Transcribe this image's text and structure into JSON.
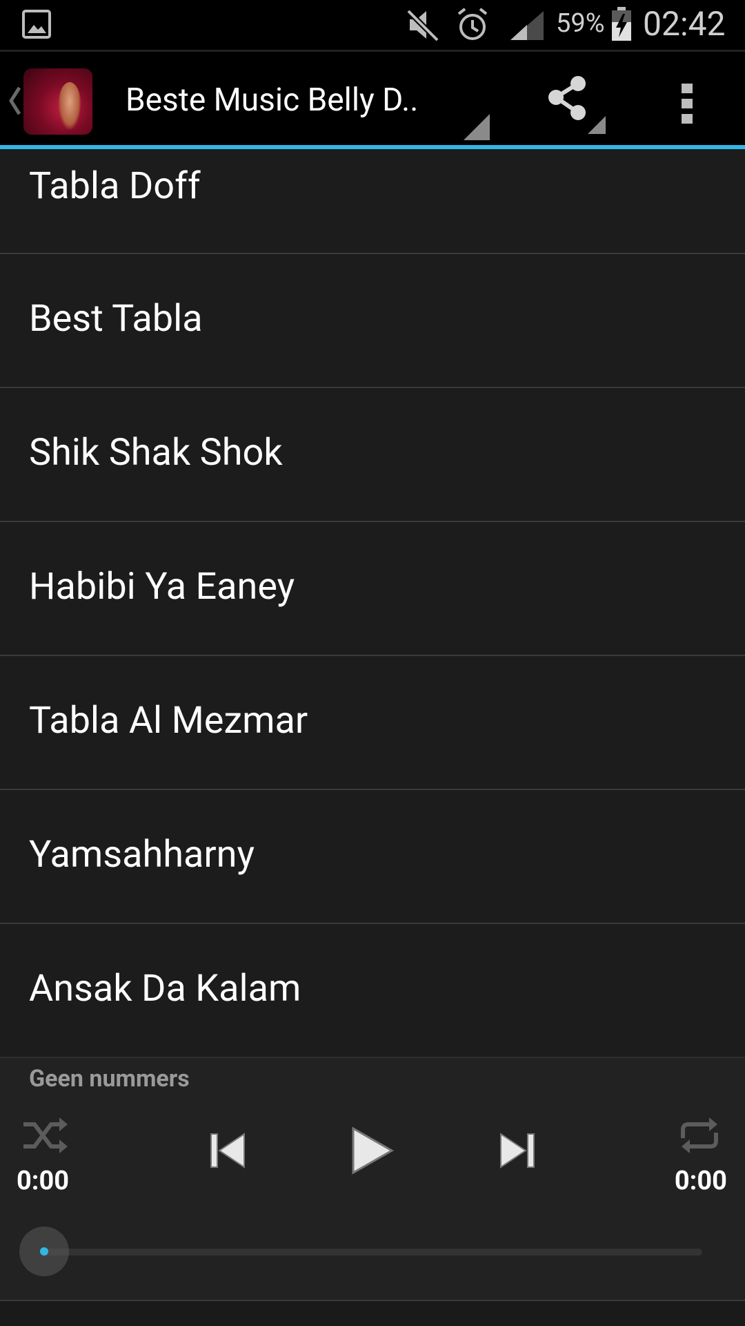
{
  "status_bar": {
    "icons": [
      "gallery-icon",
      "mute-icon",
      "alarm-icon",
      "signal-icon",
      "battery-charging-icon"
    ],
    "battery_percent": "59%",
    "time": "02:42"
  },
  "action_bar": {
    "title": "Beste Music Belly D..",
    "icons": [
      "up-caret-icon",
      "share-icon",
      "overflow-menu-icon"
    ],
    "accent_color": "#33b5e5"
  },
  "songs": [
    {
      "title": "Tabla Doff"
    },
    {
      "title": "Best Tabla"
    },
    {
      "title": "Shik Shak Shok"
    },
    {
      "title": "Habibi Ya Eaney"
    },
    {
      "title": "Tabla Al Mezmar"
    },
    {
      "title": "Yamsahharny"
    },
    {
      "title": "Ansak Da Kalam"
    }
  ],
  "player": {
    "now_playing": "Geen nummers",
    "elapsed": "0:00",
    "total": "0:00",
    "progress": 0,
    "controls": [
      "shuffle-icon",
      "previous-icon",
      "play-icon",
      "next-icon",
      "repeat-icon"
    ]
  }
}
